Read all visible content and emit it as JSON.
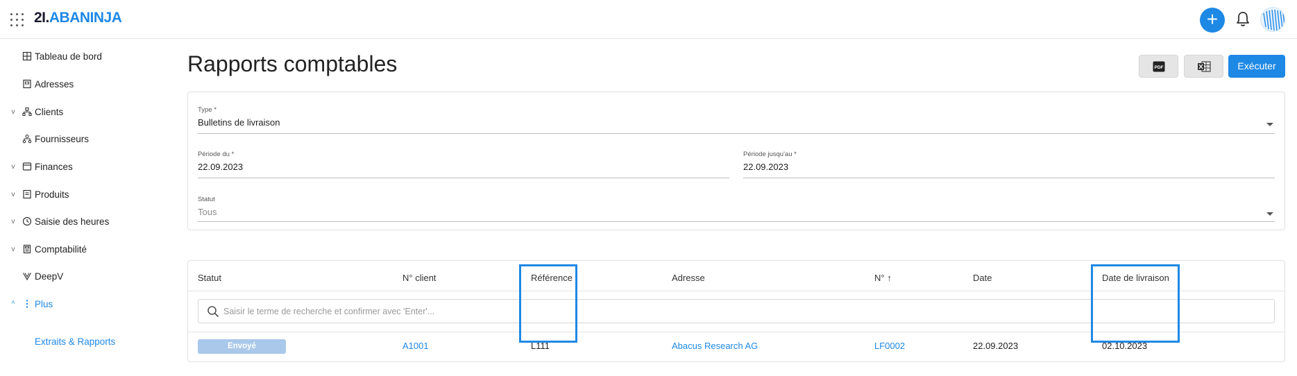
{
  "brand": {
    "num": "2I.",
    "name": "ABANINJA",
    "accent": "#1e88e5"
  },
  "header": {
    "add_label": "+"
  },
  "sidebar": {
    "items": [
      {
        "label": "Tableau de bord",
        "icon": "dashboard-icon",
        "chevron": ""
      },
      {
        "label": "Adresses",
        "icon": "address-book-icon",
        "chevron": ""
      },
      {
        "label": "Clients",
        "icon": "clients-icon",
        "chevron": "v"
      },
      {
        "label": "Fournisseurs",
        "icon": "suppliers-icon",
        "chevron": ""
      },
      {
        "label": "Finances",
        "icon": "finance-icon",
        "chevron": "v"
      },
      {
        "label": "Produits",
        "icon": "products-icon",
        "chevron": "v"
      },
      {
        "label": "Saisie des heures",
        "icon": "clock-icon",
        "chevron": "v"
      },
      {
        "label": "Comptabilité",
        "icon": "accounting-icon",
        "chevron": "v"
      },
      {
        "label": "DeepV",
        "icon": "deepv-icon",
        "chevron": ""
      },
      {
        "label": "Plus",
        "icon": "more-vertical-icon",
        "chevron": "^"
      }
    ],
    "sub_item": "Extraits & Rapports"
  },
  "page": {
    "title": "Rapports comptables",
    "run_label": "Exécuter",
    "pdf_label": "PDF"
  },
  "form": {
    "type_label": "Type *",
    "type_value": "Bulletins de livraison",
    "from_label": "Période du *",
    "from_value": "22.09.2023",
    "to_label": "Période jusqu'au *",
    "to_value": "22.09.2023",
    "status_label": "Statut",
    "status_value": "Tous"
  },
  "table": {
    "columns": [
      "Statut",
      "N° client",
      "Référence",
      "Adresse",
      "N°",
      "Date",
      "Date de livraison"
    ],
    "sort_indicator": "↑",
    "search_placeholder": "Saisir le terme de recherche et confirmer avec 'Enter'...",
    "rows": [
      {
        "status": "Envoyé",
        "client_no": "A1001",
        "reference": "L111",
        "address": "Abacus Research AG",
        "number": "LF0002",
        "date": "22.09.2023",
        "delivery_date": "02.10.2023"
      }
    ]
  }
}
